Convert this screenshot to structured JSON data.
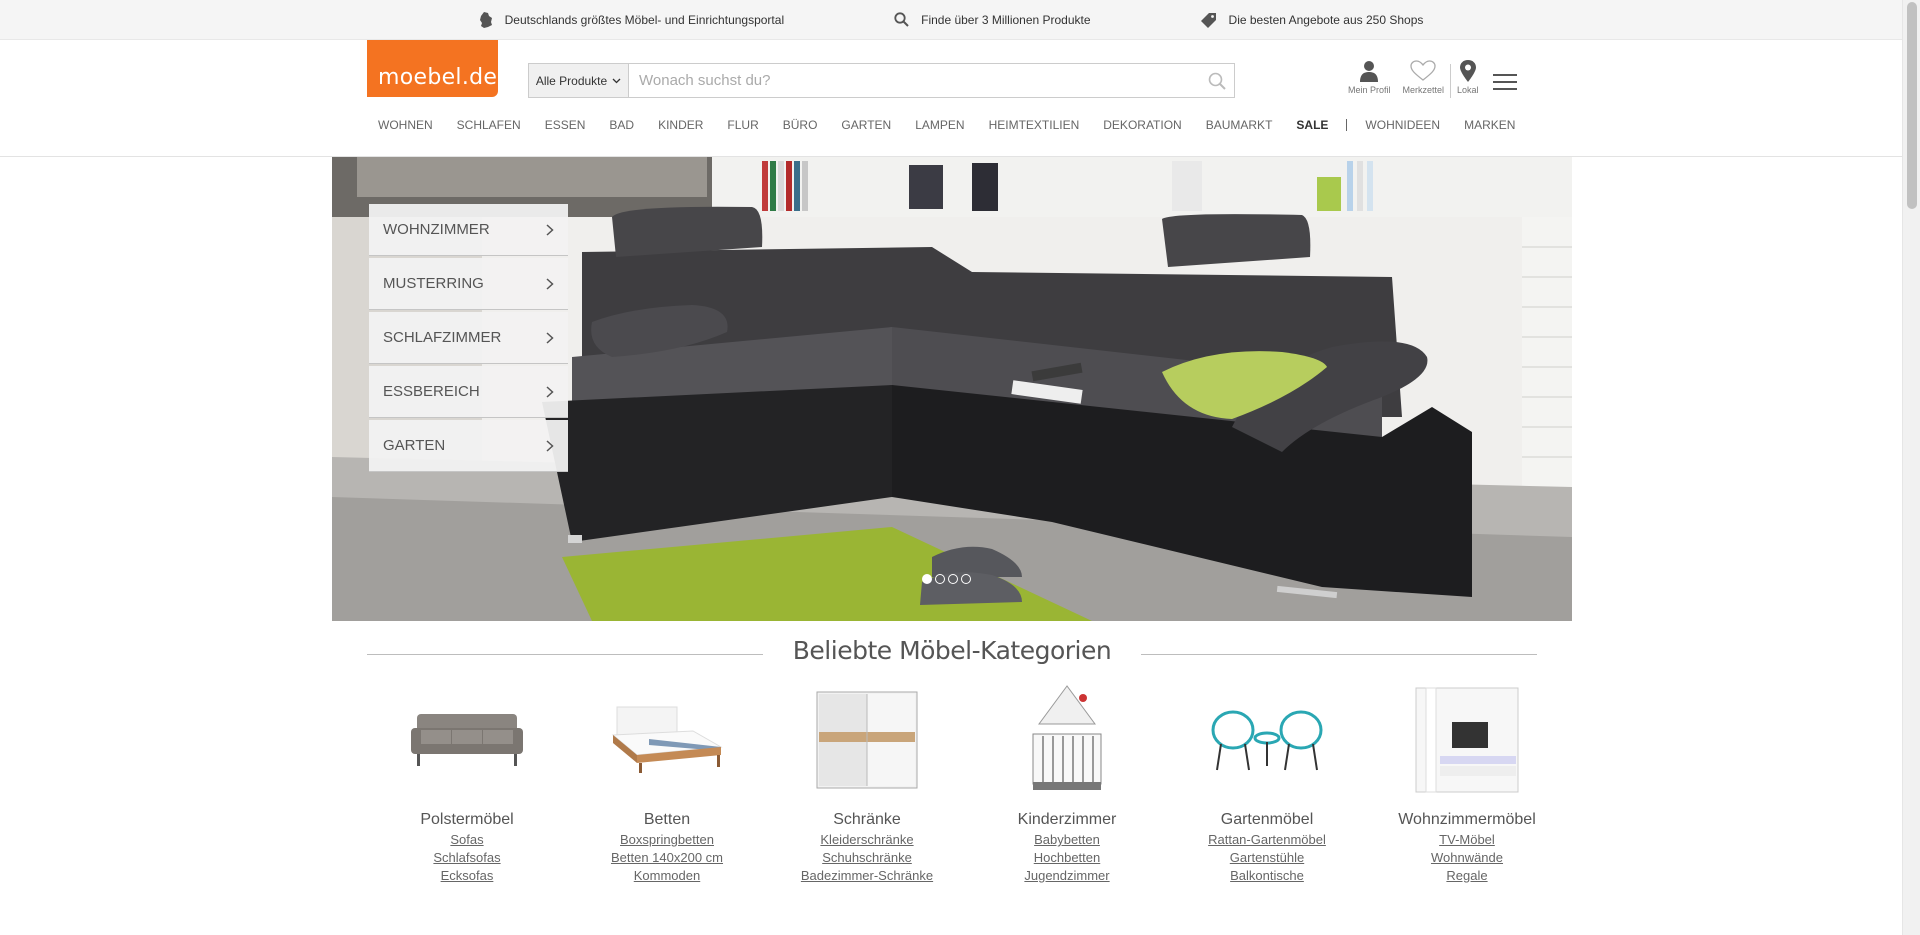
{
  "infobar": [
    {
      "icon": "germany-icon",
      "text": "Deutschlands größtes Möbel- und Einrichtungsportal"
    },
    {
      "icon": "search-icon",
      "text": "Finde über 3 Millionen Produkte"
    },
    {
      "icon": "tag-icon",
      "text": "Die besten Angebote aus 250 Shops"
    }
  ],
  "brand": {
    "logo_text": "moebel.de",
    "color": "#f47321"
  },
  "search": {
    "category": "Alle Produkte",
    "placeholder": "Wonach suchst du?"
  },
  "tools": {
    "profile": "Mein Profil",
    "wishlist": "Merkzettel",
    "local": "Lokal"
  },
  "nav": {
    "items": [
      "WOHNEN",
      "SCHLAFEN",
      "ESSEN",
      "BAD",
      "KINDER",
      "FLUR",
      "BÜRO",
      "GARTEN",
      "LAMPEN",
      "HEIMTEXTILIEN",
      "DEKORATION",
      "BAUMARKT"
    ],
    "sale": "SALE",
    "extra": [
      "WOHNIDEEN",
      "MARKEN"
    ]
  },
  "hero": {
    "menu": [
      "WOHNZIMMER",
      "MUSTERRING",
      "SCHLAFZIMMER",
      "ESSBEREICH",
      "GARTEN"
    ],
    "slides_total": 4,
    "slide_active": 1
  },
  "categories": {
    "heading": "Beliebte Möbel-Kategorien",
    "columns": [
      {
        "title": "Polstermöbel",
        "links": [
          "Sofas",
          "Schlafsofas",
          "Ecksofas"
        ],
        "icon": "sofa-image"
      },
      {
        "title": "Betten",
        "links": [
          "Boxspringbetten",
          "Betten 140x200 cm",
          "Kommoden"
        ],
        "icon": "bed-image"
      },
      {
        "title": "Schränke",
        "links": [
          "Kleiderschränke",
          "Schuhschränke",
          "Badezimmer-Schränke"
        ],
        "icon": "wardrobe-image"
      },
      {
        "title": "Kinderzimmer",
        "links": [
          "Babybetten",
          "Hochbetten",
          "Jugendzimmer"
        ],
        "icon": "crib-image"
      },
      {
        "title": "Gartenmöbel",
        "links": [
          "Rattan-Gartenmöbel",
          "Gartenstühle",
          "Balkontische"
        ],
        "icon": "garden-chairs-image"
      },
      {
        "title": "Wohnzimmermöbel",
        "links": [
          "TV-Möbel",
          "Wohnwände",
          "Regale"
        ],
        "icon": "tv-unit-image"
      }
    ]
  }
}
